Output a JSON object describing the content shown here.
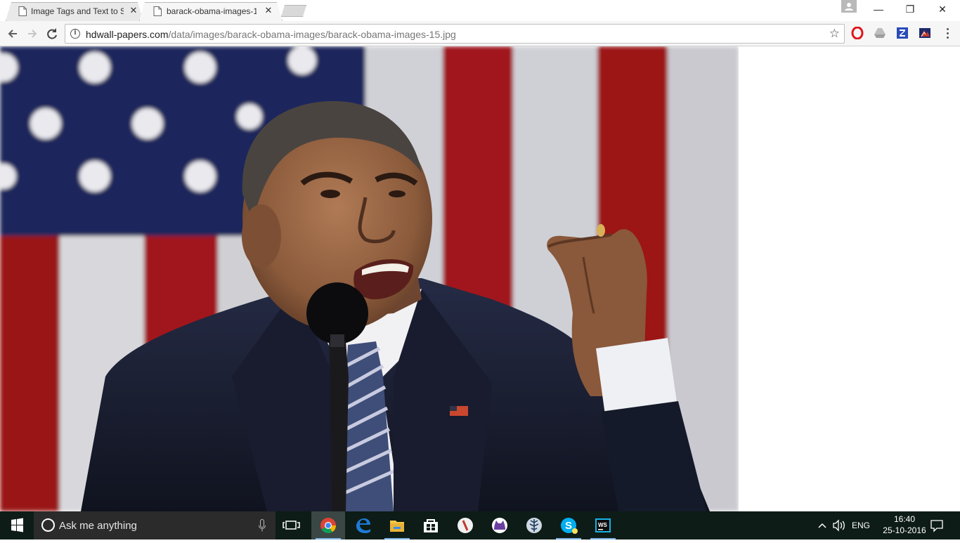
{
  "browser": {
    "tabs": [
      {
        "title": "Image Tags and Text to S",
        "active": false
      },
      {
        "title": "barack-obama-images-1",
        "active": true
      }
    ],
    "close_glyph": "✕",
    "window_controls": {
      "minimize": "—",
      "restore": "❐",
      "close": "✕"
    },
    "address": {
      "host": "hdwall-papers.com",
      "path": "/data/images/barack-obama-images/barack-obama-images-15.jpg"
    },
    "icons": [
      "back-icon",
      "forward-icon",
      "reload-icon",
      "info-icon",
      "star-icon",
      "opera-icon",
      "google-drive-icon",
      "zotero-icon",
      "extension-icon",
      "menu-icon"
    ]
  },
  "page": {
    "image_description_colors": {
      "flag_blue": "#1e2a5e",
      "flag_red": "#9c1317",
      "flag_white": "#d9d9dc",
      "suit": "#1a1f33"
    }
  },
  "taskbar": {
    "search_placeholder": "Ask me anything",
    "pinned": [
      "task-view-icon",
      "chrome-icon",
      "edge-icon",
      "file-explorer-icon",
      "store-icon",
      "app-icon",
      "cat-app-icon",
      "tree-app-icon",
      "skype-icon",
      "webstorm-icon"
    ],
    "tray": {
      "language": "ENG"
    },
    "clock": {
      "time": "16:40",
      "date": "25-10-2016"
    }
  }
}
